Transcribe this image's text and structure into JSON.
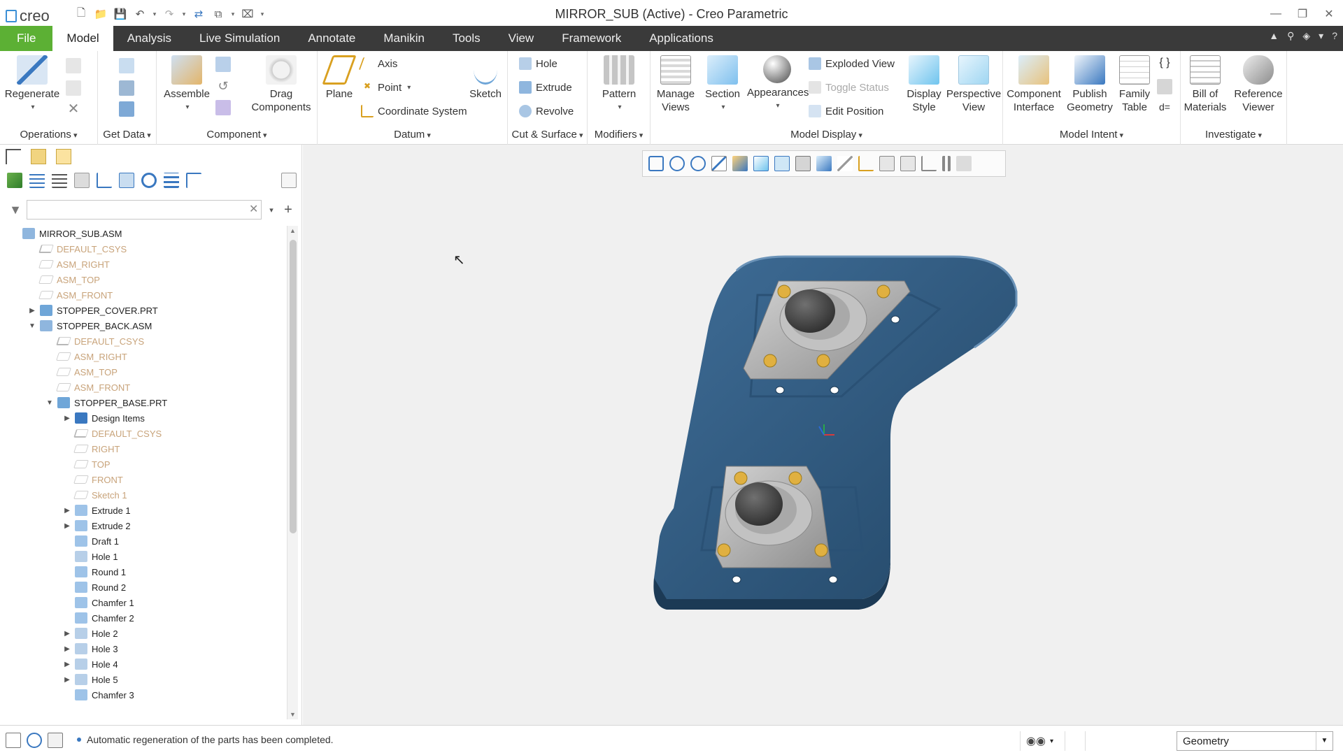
{
  "app": {
    "logo_text": "creo",
    "window_title": "MIRROR_SUB (Active) - Creo Parametric"
  },
  "tabs": [
    "File",
    "Model",
    "Analysis",
    "Live Simulation",
    "Annotate",
    "Manikin",
    "Tools",
    "View",
    "Framework",
    "Applications"
  ],
  "active_tab": "Model",
  "ribbon": {
    "groups": {
      "operations": "Operations",
      "get_data": "Get Data",
      "component": "Component",
      "datum": "Datum",
      "cut_surface": "Cut & Surface",
      "modifiers": "Modifiers",
      "model_display": "Model Display",
      "model_intent": "Model Intent",
      "investigate": "Investigate"
    },
    "buttons": {
      "regenerate": "Regenerate",
      "assemble": "Assemble",
      "drag_1": "Drag",
      "drag_2": "Components",
      "plane": "Plane",
      "axis": "Axis",
      "point": "Point",
      "coordinate_system": "Coordinate System",
      "sketch": "Sketch",
      "hole": "Hole",
      "extrude": "Extrude",
      "revolve": "Revolve",
      "pattern": "Pattern",
      "manage_1": "Manage",
      "manage_2": "Views",
      "section": "Section",
      "appearances": "Appearances",
      "exploded_view": "Exploded View",
      "toggle_status": "Toggle Status",
      "edit_position": "Edit Position",
      "display_1": "Display",
      "display_2": "Style",
      "perspective_1": "Perspective",
      "perspective_2": "View",
      "component_interface_1": "Component",
      "component_interface_2": "Interface",
      "publish_1": "Publish",
      "publish_2": "Geometry",
      "family_1": "Family",
      "family_2": "Table",
      "bom_1": "Bill of",
      "bom_2": "Materials",
      "ref_1": "Reference",
      "ref_2": "Viewer"
    }
  },
  "tree": {
    "search_placeholder": "",
    "items": [
      {
        "label": "MIRROR_SUB.ASM",
        "level": 0,
        "exp": "",
        "type": "asm"
      },
      {
        "label": "DEFAULT_CSYS",
        "level": 1,
        "exp": "",
        "type": "csys"
      },
      {
        "label": "ASM_RIGHT",
        "level": 1,
        "exp": "",
        "type": "datum"
      },
      {
        "label": "ASM_TOP",
        "level": 1,
        "exp": "",
        "type": "datum"
      },
      {
        "label": "ASM_FRONT",
        "level": 1,
        "exp": "",
        "type": "datum"
      },
      {
        "label": "STOPPER_COVER.PRT",
        "level": 1,
        "exp": "▶",
        "type": "part"
      },
      {
        "label": "STOPPER_BACK.ASM",
        "level": 1,
        "exp": "▼",
        "type": "asm"
      },
      {
        "label": "DEFAULT_CSYS",
        "level": 2,
        "exp": "",
        "type": "csys"
      },
      {
        "label": "ASM_RIGHT",
        "level": 2,
        "exp": "",
        "type": "datum"
      },
      {
        "label": "ASM_TOP",
        "level": 2,
        "exp": "",
        "type": "datum"
      },
      {
        "label": "ASM_FRONT",
        "level": 2,
        "exp": "",
        "type": "datum"
      },
      {
        "label": "STOPPER_BASE.PRT",
        "level": 2,
        "exp": "▼",
        "type": "part"
      },
      {
        "label": "Design Items",
        "level": 3,
        "exp": "▶",
        "type": "list"
      },
      {
        "label": "DEFAULT_CSYS",
        "level": 3,
        "exp": "",
        "type": "csys"
      },
      {
        "label": "RIGHT",
        "level": 3,
        "exp": "",
        "type": "datum"
      },
      {
        "label": "TOP",
        "level": 3,
        "exp": "",
        "type": "datum"
      },
      {
        "label": "FRONT",
        "level": 3,
        "exp": "",
        "type": "datum"
      },
      {
        "label": "Sketch 1",
        "level": 3,
        "exp": "",
        "type": "sketch"
      },
      {
        "label": "Extrude 1",
        "level": 3,
        "exp": "▶",
        "type": "feat"
      },
      {
        "label": "Extrude 2",
        "level": 3,
        "exp": "▶",
        "type": "feat"
      },
      {
        "label": "Draft 1",
        "level": 3,
        "exp": "",
        "type": "feat"
      },
      {
        "label": "Hole 1",
        "level": 3,
        "exp": "",
        "type": "hole"
      },
      {
        "label": "Round 1",
        "level": 3,
        "exp": "",
        "type": "feat"
      },
      {
        "label": "Round 2",
        "level": 3,
        "exp": "",
        "type": "feat"
      },
      {
        "label": "Chamfer 1",
        "level": 3,
        "exp": "",
        "type": "feat"
      },
      {
        "label": "Chamfer 2",
        "level": 3,
        "exp": "",
        "type": "feat"
      },
      {
        "label": "Hole 2",
        "level": 3,
        "exp": "▶",
        "type": "hole"
      },
      {
        "label": "Hole 3",
        "level": 3,
        "exp": "▶",
        "type": "hole"
      },
      {
        "label": "Hole 4",
        "level": 3,
        "exp": "▶",
        "type": "hole"
      },
      {
        "label": "Hole 5",
        "level": 3,
        "exp": "▶",
        "type": "hole"
      },
      {
        "label": "Chamfer 3",
        "level": 3,
        "exp": "",
        "type": "feat"
      }
    ]
  },
  "status": {
    "message": "Automatic regeneration of the parts has been completed.",
    "filter_value": "Geometry"
  },
  "colors": {
    "file_tab": "#5cb034",
    "tab_bar": "#3a3a3a",
    "model_body": "#2f5b82",
    "plate": "#b5b5b5",
    "screw": "#e0b040"
  }
}
